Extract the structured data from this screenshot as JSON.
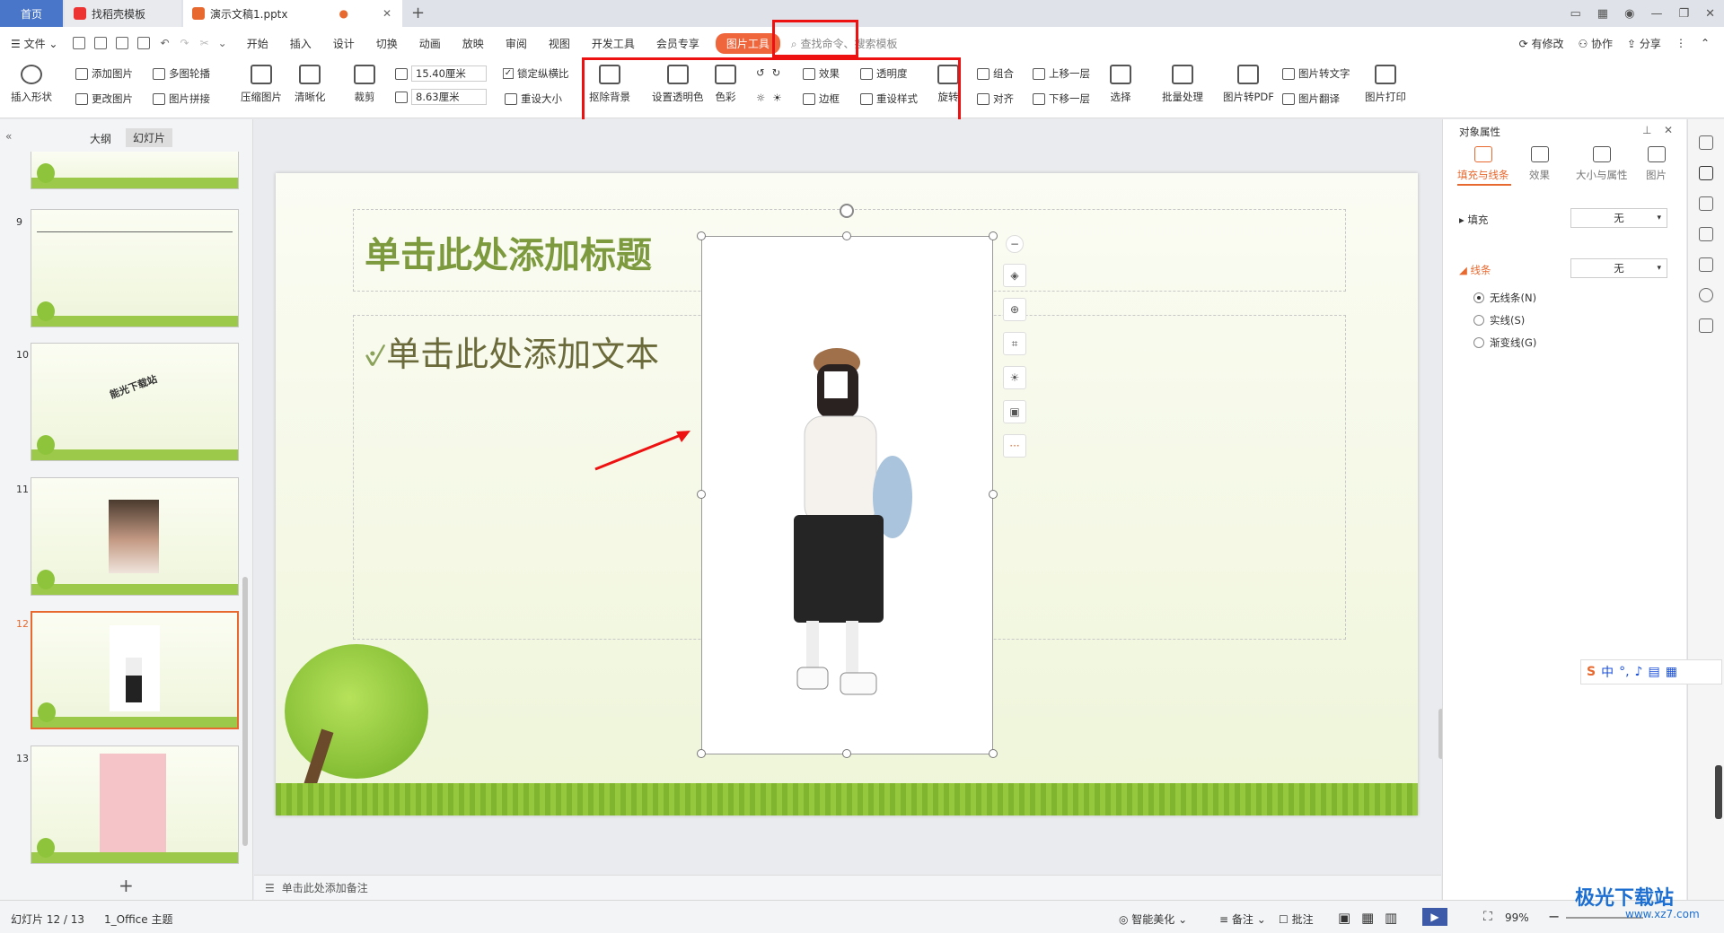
{
  "tabs": {
    "home": "首页",
    "template": "找稻壳模板",
    "document": "演示文稿1.pptx"
  },
  "menu": {
    "file": "文件",
    "items": [
      "开始",
      "插入",
      "设计",
      "切换",
      "动画",
      "放映",
      "审阅",
      "视图",
      "开发工具",
      "会员专享"
    ],
    "picture_tools": "图片工具",
    "search": "查找命令、搜索模板",
    "modified": "有修改",
    "collab": "协作",
    "share": "分享"
  },
  "ribbon": {
    "insert_shape": "插入形状",
    "add_image": "添加图片",
    "multi_outline": "多图轮播",
    "change_image": "更改图片",
    "image_splice": "图片拼接",
    "compress": "压缩图片",
    "sharpen": "清晰化",
    "crop": "裁剪",
    "width": "15.40厘米",
    "height": "8.63厘米",
    "lock_ratio": "锁定纵横比",
    "reset_size": "重设大小",
    "remove_bg": "抠除背景",
    "set_transparent": "设置透明色",
    "color": "色彩",
    "effects": "效果",
    "transparency": "透明度",
    "border": "边框",
    "reset_style": "重设样式",
    "rotate": "旋转",
    "group": "组合",
    "align": "对齐",
    "bring_forward": "上移一层",
    "send_backward": "下移一层",
    "select": "选择",
    "batch": "批量处理",
    "to_pdf": "图片转PDF",
    "to_text": "图片转文字",
    "translate": "图片翻译",
    "print": "图片打印"
  },
  "left": {
    "outline_tab": "大纲",
    "slides_tab": "幻灯片",
    "slide_numbers": [
      "9",
      "10",
      "11",
      "12",
      "13"
    ],
    "thumb10_text": "能光下载站",
    "add": "+"
  },
  "slide": {
    "title_placeholder": "单击此处添加标题",
    "body_placeholder": "单击此处添加文本"
  },
  "notes": "单击此处添加备注",
  "panel": {
    "header": "对象属性",
    "tabs": [
      "填充与线条",
      "效果",
      "大小与属性",
      "图片"
    ],
    "fill": "填充",
    "fill_value": "无",
    "line": "线条",
    "line_value": "无",
    "radios": [
      "无线条(N)",
      "实线(S)",
      "渐变线(G)"
    ]
  },
  "status": {
    "slide": "幻灯片 12 / 13",
    "theme": "1_Office 主题",
    "beautify": "智能美化",
    "notes": "备注",
    "comments": "批注",
    "zoom": "99%"
  },
  "ime": {
    "label": "中"
  },
  "watermark": {
    "name": "极光下载站",
    "url": "www.xz7.com"
  },
  "colors": {
    "accent": "#f0663c",
    "highlight": "#e11111",
    "title_green": "#7d9b3e"
  }
}
